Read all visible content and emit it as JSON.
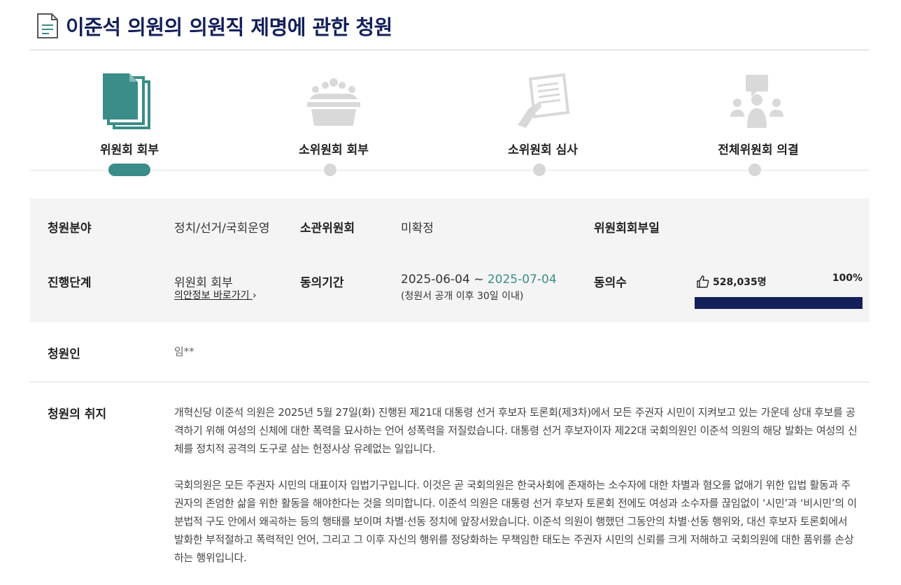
{
  "title": "이준석 의원의 의원직 제명에 관한 청원",
  "stages": [
    {
      "label": "위원회 회부",
      "icon": "documents-icon",
      "active": true
    },
    {
      "label": "소위원회 회부",
      "icon": "meeting-icon",
      "active": false
    },
    {
      "label": "소위원회 심사",
      "icon": "review-document-icon",
      "active": false
    },
    {
      "label": "전체위원회 의결",
      "icon": "discussion-icon",
      "active": false
    }
  ],
  "info": {
    "field_label": "청원분야",
    "field_value": "정치/선거/국회운영",
    "committee_label": "소관위원회",
    "committee_value": "미확정",
    "referral_date_label": "위원회회부일",
    "stage_label": "진행단계",
    "stage_value": "위원회 회부",
    "bill_link": "의안정보 바로가기",
    "period_label": "동의기간",
    "period_start": "2025-06-04 ~ ",
    "period_end": "2025-07-04",
    "period_note": "(청원서 공개 이후 30일 이내)",
    "agree_label": "동의수",
    "agree_count": "528,035명",
    "agree_percent": "100%",
    "agree_fraction": 1.0
  },
  "petitioner": {
    "label": "청원인",
    "value": "임**"
  },
  "purpose": {
    "label": "청원의 취지",
    "paragraphs": [
      "개혁신당 이준석 의원은 2025년 5월 27일(화) 진행된 제21대 대통령 선거 후보자 토론회(제3차)에서 모든 주권자 시민이 지켜보고 있는 가운데 상대 후보를 공격하기 위해 여성의 신체에 대한 폭력을 묘사하는 언어 성폭력을 저질렀습니다. 대통령 선거 후보자이자 제22대 국회의원인 이준석 의원의 해당 발화는 여성의 신체를 정치적 공격의 도구로 삼는 헌정사상 유례없는 일입니다.",
      "국회의원은 모든 주권자 시민의 대표이자 입법기구입니다. 이것은 곧 국회의원은 한국사회에 존재하는 소수자에 대한 차별과 혐오를 없애기 위한 입법 활동과 주권자의 존엄한 삶을 위한 활동을 해야한다는 것을 의미합니다. 이준석 의원은 대통령 선거 후보자 토론회 전에도 여성과 소수자를 끊임없이 ‘시민’과 ‘비시민’의 이분법적 구도 안에서 왜곡하는 등의 행태를 보이며 차별·선동 정치에 앞장서왔습니다. 이준석 의원이 행했던 그동안의 차별·선동 행위와, 대선 후보자 토론회에서 발화한 부적절하고 폭력적인 언어, 그리고 그 이후 자신의 행위를 정당화하는 무책임한 태도는 주권자 시민의 신뢰를 크게 저해하고 국회의원에 대한 품위를 손상하는 행위입니다."
    ]
  },
  "colors": {
    "title": "#13205a",
    "accent": "#3a8d88",
    "progress": "#13205a",
    "inactive": "#d7d7d7"
  }
}
